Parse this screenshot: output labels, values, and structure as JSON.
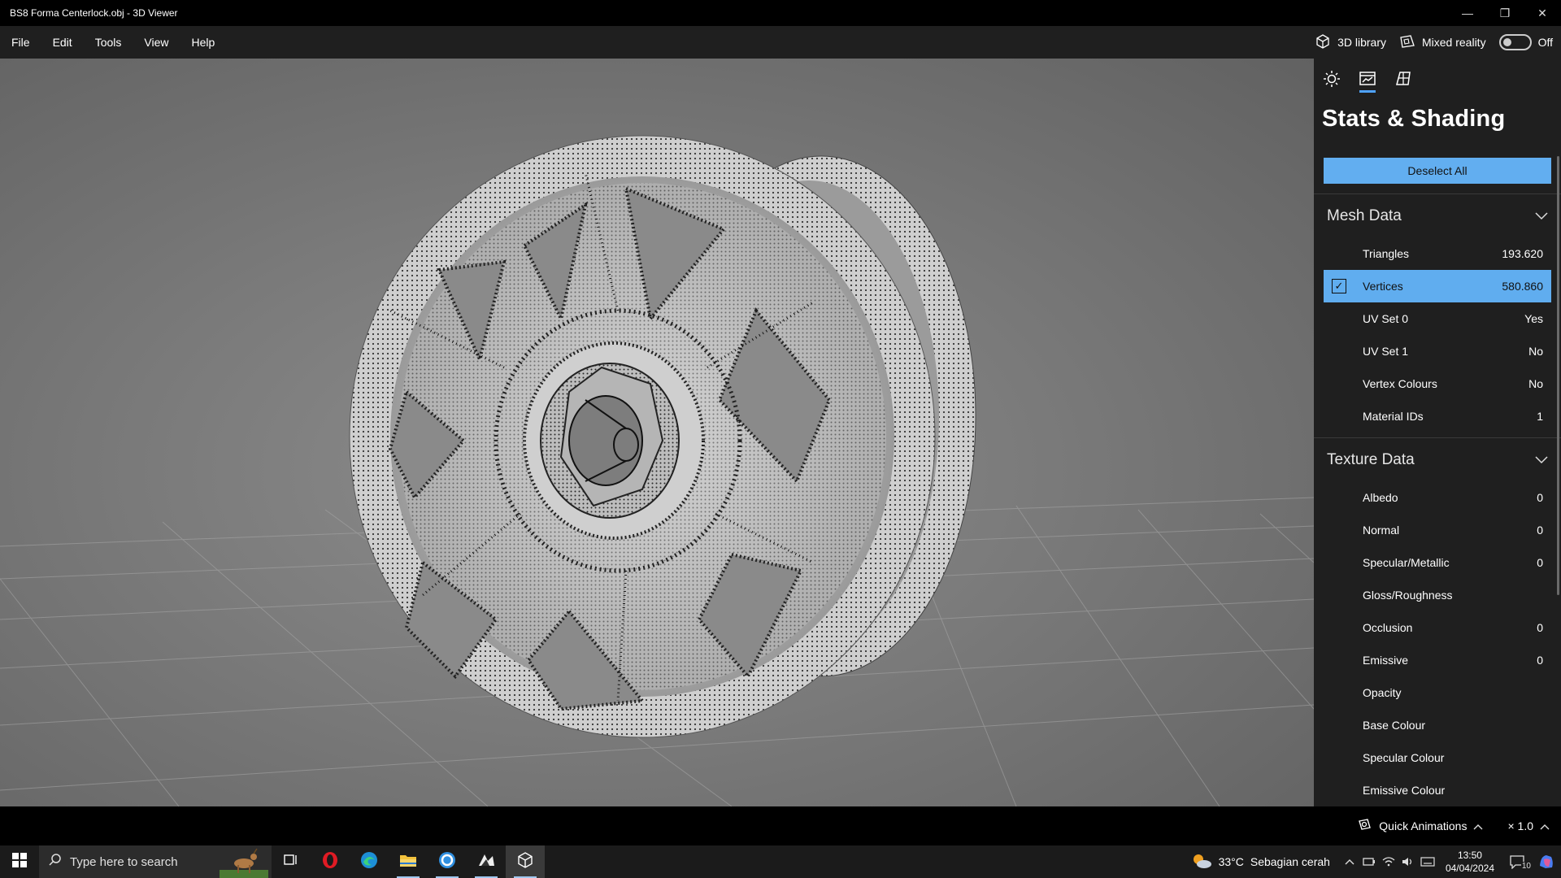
{
  "window": {
    "title": "BS8 Forma Centerlock.obj - 3D Viewer",
    "minimize": "—",
    "restore": "❐",
    "close": "✕"
  },
  "menu": {
    "items": [
      "File",
      "Edit",
      "Tools",
      "View",
      "Help"
    ],
    "library_label": "3D library",
    "mixed_reality_label": "Mixed reality",
    "mixed_reality_state": "Off"
  },
  "panel": {
    "title": "Stats & Shading",
    "deselect_label": "Deselect All",
    "mesh": {
      "heading": "Mesh Data",
      "rows": [
        {
          "label": "Triangles",
          "value": "193.620"
        },
        {
          "label": "Vertices",
          "value": "580.860",
          "selected": true
        },
        {
          "label": "UV Set 0",
          "value": "Yes"
        },
        {
          "label": "UV Set 1",
          "value": "No"
        },
        {
          "label": "Vertex Colours",
          "value": "No"
        },
        {
          "label": "Material IDs",
          "value": "1"
        }
      ]
    },
    "texture": {
      "heading": "Texture Data",
      "rows": [
        {
          "label": "Albedo",
          "value": "0"
        },
        {
          "label": "Normal",
          "value": "0"
        },
        {
          "label": "Specular/Metallic",
          "value": "0"
        },
        {
          "label": "Gloss/Roughness",
          "value": ""
        },
        {
          "label": "Occlusion",
          "value": "0"
        },
        {
          "label": "Emissive",
          "value": "0"
        },
        {
          "label": "Opacity",
          "value": ""
        },
        {
          "label": "Base Colour",
          "value": ""
        },
        {
          "label": "Specular Colour",
          "value": ""
        },
        {
          "label": "Emissive Colour",
          "value": ""
        }
      ]
    }
  },
  "status": {
    "quick_animations": "Quick Animations",
    "speed": "× 1.0"
  },
  "taskbar": {
    "search_placeholder": "Type here to search",
    "temperature": "33°C",
    "weather": "Sebagian cerah",
    "time": "13:50",
    "date": "04/04/2024",
    "notifications": "10"
  },
  "colors": {
    "accent": "#62aef0",
    "panel_bg": "#1f1f1f"
  }
}
